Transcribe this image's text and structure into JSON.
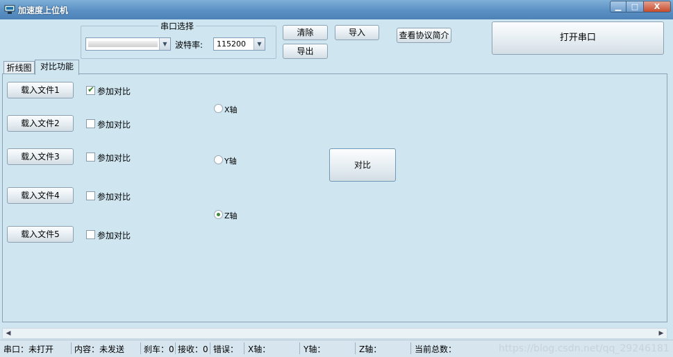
{
  "window": {
    "title": "加速度上位机",
    "min_glyph": "▁",
    "max_glyph": "□",
    "close_glyph": "X"
  },
  "serial": {
    "group_title": "串口选择",
    "port_value": "",
    "baud_label": "波特率:",
    "baud_value": "115200"
  },
  "toolbar": {
    "clear_label": "清除",
    "export_label": "导出",
    "import_label": "导入",
    "protocol_label": "查看协议简介",
    "open_port_label": "打开串口"
  },
  "tabs": [
    {
      "label": "折线图"
    },
    {
      "label": "对比功能"
    }
  ],
  "compare": {
    "files": [
      {
        "button": "载入文件1",
        "checkbox_label": "参加对比",
        "checked": true
      },
      {
        "button": "载入文件2",
        "checkbox_label": "参加对比",
        "checked": false
      },
      {
        "button": "载入文件3",
        "checkbox_label": "参加对比",
        "checked": false
      },
      {
        "button": "载入文件4",
        "checkbox_label": "参加对比",
        "checked": false
      },
      {
        "button": "载入文件5",
        "checkbox_label": "参加对比",
        "checked": false
      }
    ],
    "axes": [
      {
        "label": "X轴",
        "selected": false
      },
      {
        "label": "Y轴",
        "selected": false
      },
      {
        "label": "Z轴",
        "selected": true
      }
    ],
    "compare_button": "对比"
  },
  "status": {
    "port": "串口：未打开",
    "content": "内容：未发送",
    "brake": "刹车：0",
    "receive": "接收：0",
    "error": "错误：",
    "x": "X轴：",
    "y": "Y轴：",
    "z": "Z轴：",
    "total": "当前总数："
  },
  "watermark": "https://blog.csdn.net/qq_29246181",
  "colors": {
    "background": "#cfe6f1",
    "titlebar": "#5a8fc3",
    "close": "#c84b2b",
    "check": "#2a8a2a"
  }
}
